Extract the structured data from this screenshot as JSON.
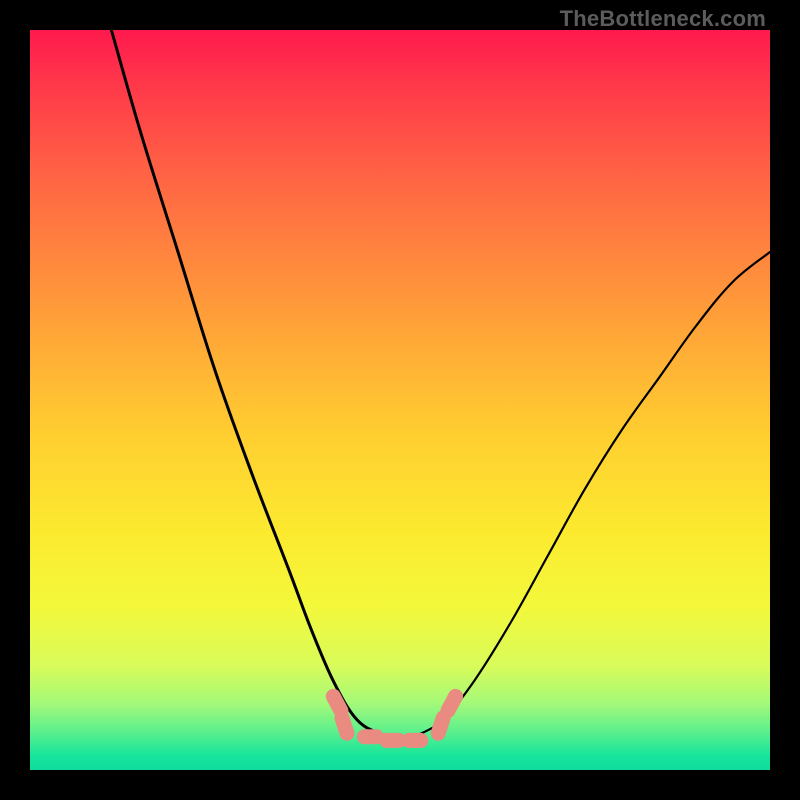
{
  "watermark": "TheBottleneck.com",
  "colors": {
    "frame_border": "#000000",
    "marker": "#e98b80",
    "curve": "#000000",
    "gradient_top": "#ff1a4d",
    "gradient_mid": "#ffcf30",
    "gradient_bottom": "#0edb9d"
  },
  "chart_data": {
    "type": "line",
    "title": "",
    "xlabel": "",
    "ylabel": "",
    "xlim": [
      0,
      100
    ],
    "ylim": [
      0,
      100
    ],
    "notes": "Background heat gradient: red (top, ~100% bottleneck) → yellow (mid) → green (bottom, ~0%). Two black curves form a V shape with a flat minimum around x≈43–55, y≈4. Salmon rounded markers cluster near the minimum (approx x=41–57) indicating near-zero bottleneck. Right curve rises shallower than left and exits right edge around y≈70.",
    "series": [
      {
        "name": "bottleneck-curve-left",
        "x": [
          11,
          15,
          20,
          25,
          30,
          35,
          38,
          41,
          44,
          47,
          50
        ],
        "values": [
          100,
          86,
          70,
          54,
          40,
          27,
          19,
          12,
          7,
          5,
          4
        ]
      },
      {
        "name": "bottleneck-curve-right",
        "x": [
          50,
          53,
          56,
          60,
          65,
          70,
          75,
          80,
          85,
          90,
          95,
          100
        ],
        "values": [
          4,
          5,
          7,
          12,
          20,
          29,
          38,
          46,
          53,
          60,
          66,
          70
        ]
      }
    ],
    "markers": [
      {
        "x": 41.5,
        "y": 9
      },
      {
        "x": 42.5,
        "y": 6
      },
      {
        "x": 46,
        "y": 4.5
      },
      {
        "x": 49,
        "y": 4
      },
      {
        "x": 52,
        "y": 4
      },
      {
        "x": 55.5,
        "y": 6
      },
      {
        "x": 57,
        "y": 9
      }
    ],
    "grid": false,
    "legend": null
  }
}
